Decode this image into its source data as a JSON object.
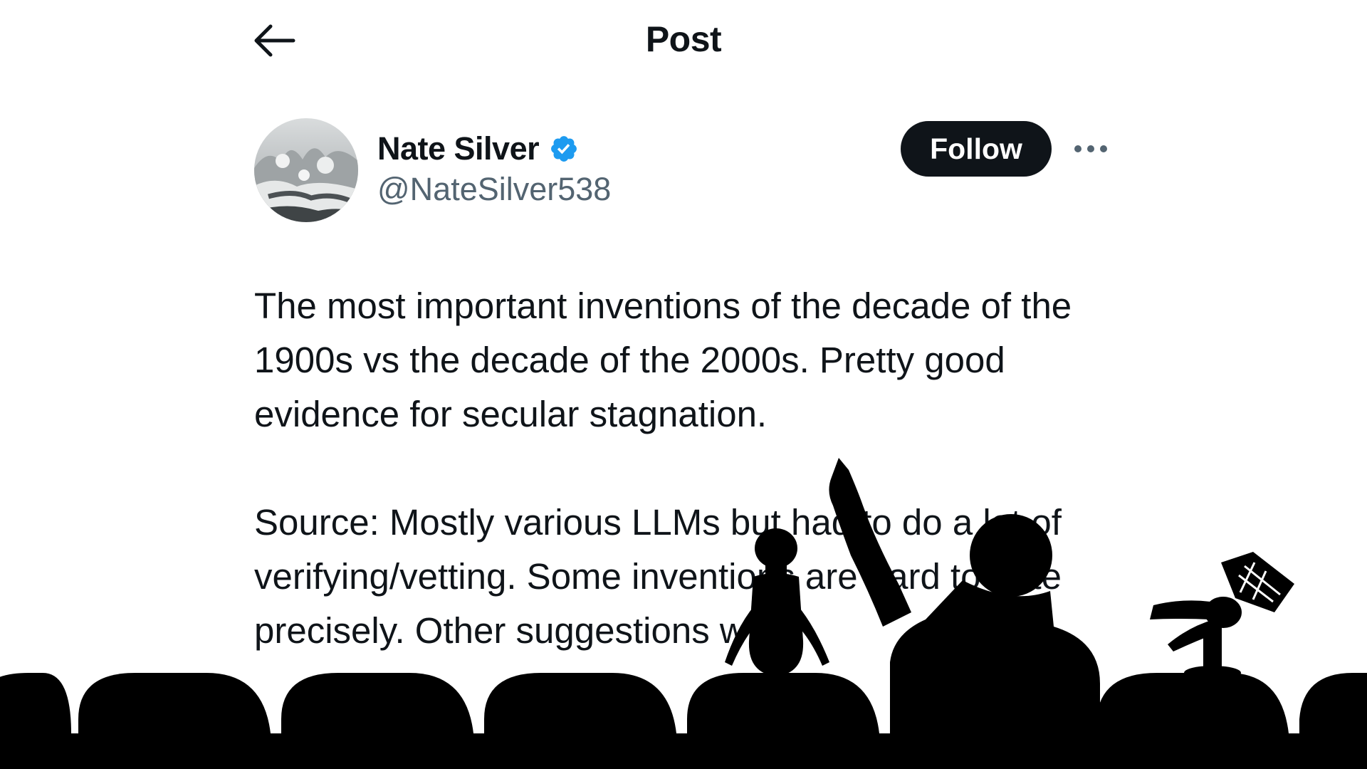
{
  "header": {
    "title": "Post"
  },
  "icons": {
    "back": "arrow-left-icon",
    "verified": "verified-badge-icon",
    "more": "more-horizontal-icon"
  },
  "author": {
    "display_name": "Nate Silver",
    "handle": "@NateSilver538",
    "verified": true
  },
  "actions": {
    "follow_label": "Follow"
  },
  "post": {
    "paragraph_1": "The most important inventions of the decade of the 1900s vs the decade of the 2000s. Pretty good evidence for secular stagnation.",
    "paragraph_2": "Source: Mostly various LLMs but had to do a lot of verifying/vetting. Some inventions are hard to date precisely. Other suggestions w"
  },
  "colors": {
    "text": "#0f1419",
    "secondary_text": "#536471",
    "verified_blue": "#1d9bf0",
    "button_bg": "#0f1419",
    "silhouette": "#000000"
  }
}
